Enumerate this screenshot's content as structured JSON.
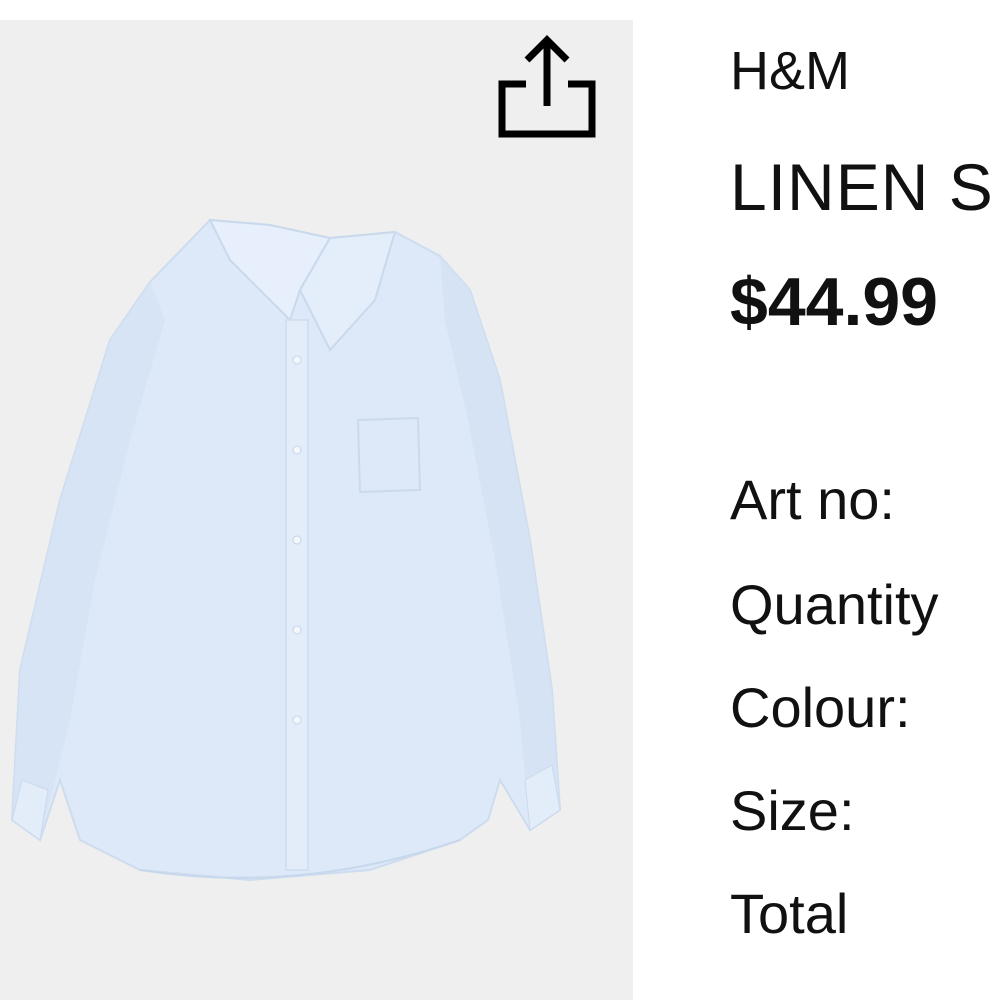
{
  "product": {
    "image_alt": "Light blue linen shirt",
    "share_icon": "share-icon",
    "colors": {
      "image_background": "#efefef",
      "shirt": "#dce8f8",
      "text": "#111111"
    }
  },
  "details": {
    "brand": "H&M",
    "name": "LINEN S",
    "price": "$44.99",
    "labels": {
      "art_no": "Art no:",
      "quantity": "Quantity",
      "colour": "Colour:",
      "size": "Size:",
      "total": "Total"
    }
  }
}
